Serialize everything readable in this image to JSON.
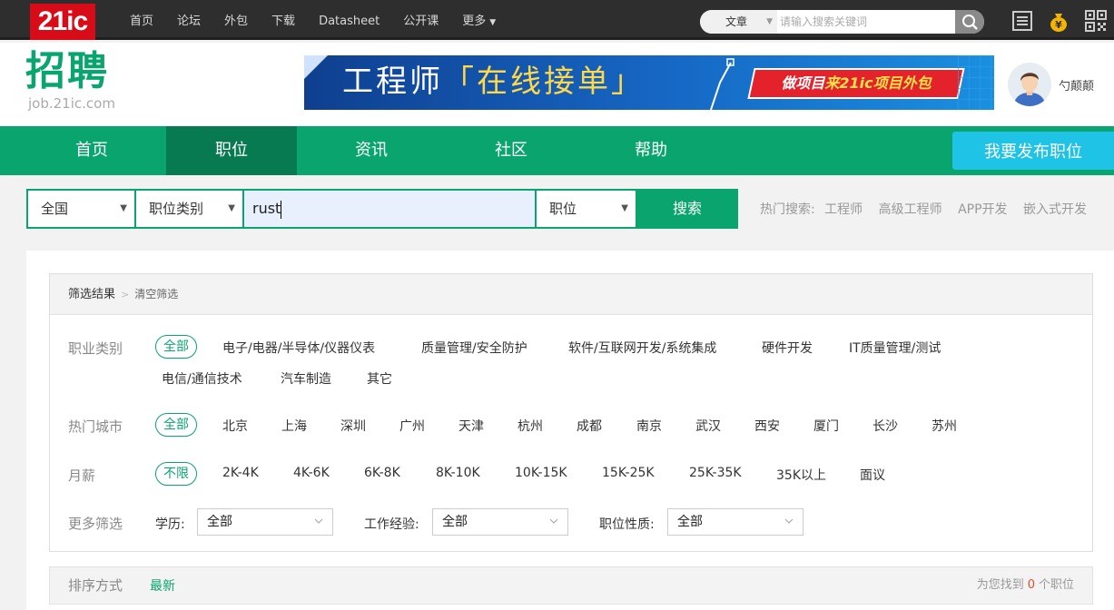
{
  "topbar": {
    "logo": "21ic",
    "nav": [
      "首页",
      "论坛",
      "外包",
      "下载",
      "Datasheet",
      "公开课",
      "更多"
    ],
    "search_type": "文章",
    "search_placeholder": "请输入搜索关键词"
  },
  "header": {
    "brand": "招聘",
    "brand_sub": "job.21ic.com",
    "banner_prefix": "工程师",
    "banner_highlight": "「在线接单」",
    "banner_cta_a": "做项目",
    "banner_cta_b": "来21ic项目外包",
    "username": "勺颠颠"
  },
  "mainnav": {
    "items": [
      "首页",
      "职位",
      "资讯",
      "社区",
      "帮助"
    ],
    "active": "职位",
    "publish": "我要发布职位"
  },
  "job_search": {
    "region": "全国",
    "category": "职位类别",
    "keyword": "rust",
    "type": "职位",
    "button": "搜索",
    "hot_label": "热门搜索:",
    "hot_terms": [
      "工程师",
      "高级工程师",
      "APP开发",
      "嵌入式开发"
    ]
  },
  "filters": {
    "title": "筛选结果",
    "clear": "清空筛选",
    "category": {
      "label": "职业类别",
      "selected": "全部",
      "options": [
        "电子/电器/半导体/仪器仪表",
        "质量管理/安全防护",
        "软件/互联网开发/系统集成",
        "硬件开发",
        "IT质量管理/测试",
        "电信/通信技术",
        "汽车制造",
        "其它"
      ]
    },
    "city": {
      "label": "热门城市",
      "selected": "全部",
      "options": [
        "北京",
        "上海",
        "深圳",
        "广州",
        "天津",
        "杭州",
        "成都",
        "南京",
        "武汉",
        "西安",
        "厦门",
        "长沙",
        "苏州"
      ]
    },
    "salary": {
      "label": "月薪",
      "selected": "不限",
      "options": [
        "2K-4K",
        "4K-6K",
        "6K-8K",
        "8K-10K",
        "10K-15K",
        "15K-25K",
        "25K-35K",
        "35K以上",
        "面议"
      ]
    },
    "more": {
      "label": "更多筛选",
      "education_label": "学历:",
      "education_value": "全部",
      "experience_label": "工作经验:",
      "experience_value": "全部",
      "nature_label": "职位性质:",
      "nature_value": "全部"
    }
  },
  "sort": {
    "label": "排序方式",
    "newest": "最新",
    "found_prefix": "为您找到",
    "count": "0",
    "found_suffix": "个职位"
  },
  "colors": {
    "brand_green": "#0aa56e",
    "nav_active": "#087a52",
    "publish_blue": "#1fc3e6",
    "logo_red": "#d70c18"
  }
}
